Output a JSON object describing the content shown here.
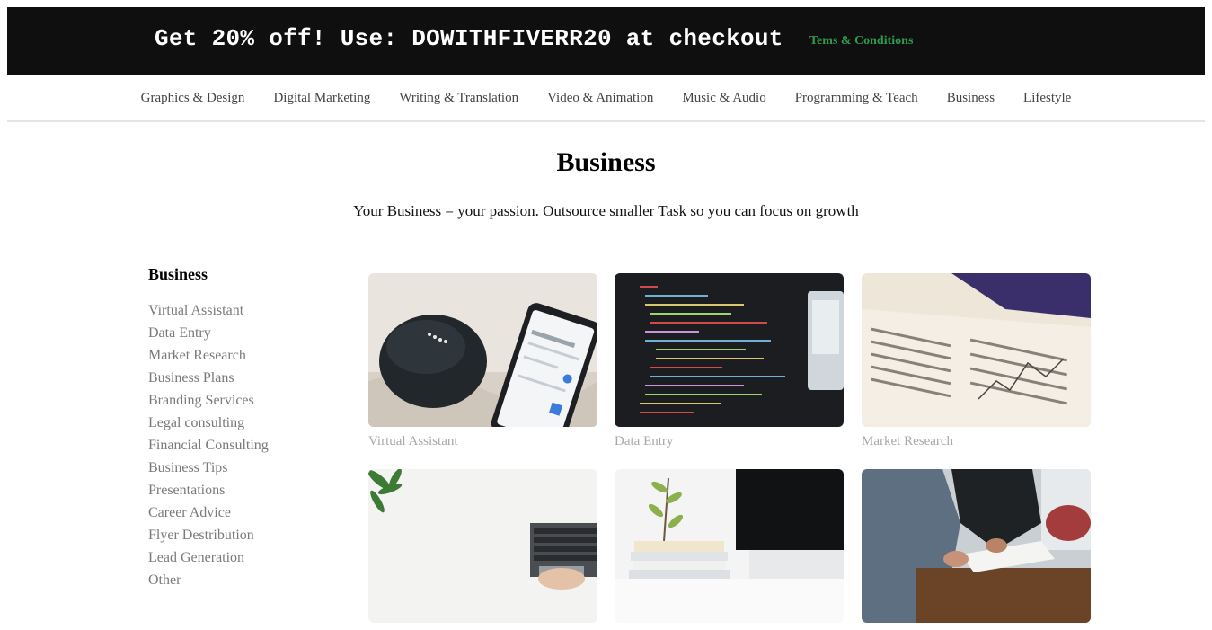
{
  "promo": {
    "text": "Get 20% off! Use: DOWITHFIVERR20 at checkout",
    "terms_label": "Tems & Conditions"
  },
  "nav": {
    "items": [
      "Graphics & Design",
      "Digital Marketing",
      "Writing & Translation",
      "Video & Animation",
      "Music & Audio",
      "Programming & Teach",
      "Business",
      "Lifestyle"
    ]
  },
  "page": {
    "title": "Business",
    "subtitle": "Your Business = your passion. Outsource smaller Task so you can focus on growth"
  },
  "sidebar": {
    "title": "Business",
    "items": [
      "Virtual Assistant",
      "Data Entry",
      "Market Research",
      "Business Plans",
      "Branding Services",
      "Legal consulting",
      "Financial Consulting",
      "Business Tips",
      "Presentations",
      "Career Advice",
      "Flyer Destribution",
      "Lead Generation",
      "Other"
    ]
  },
  "cards": [
    {
      "label": "Virtual Assistant"
    },
    {
      "label": "Data Entry"
    },
    {
      "label": "Market Research"
    },
    {
      "label": ""
    },
    {
      "label": ""
    },
    {
      "label": ""
    }
  ]
}
